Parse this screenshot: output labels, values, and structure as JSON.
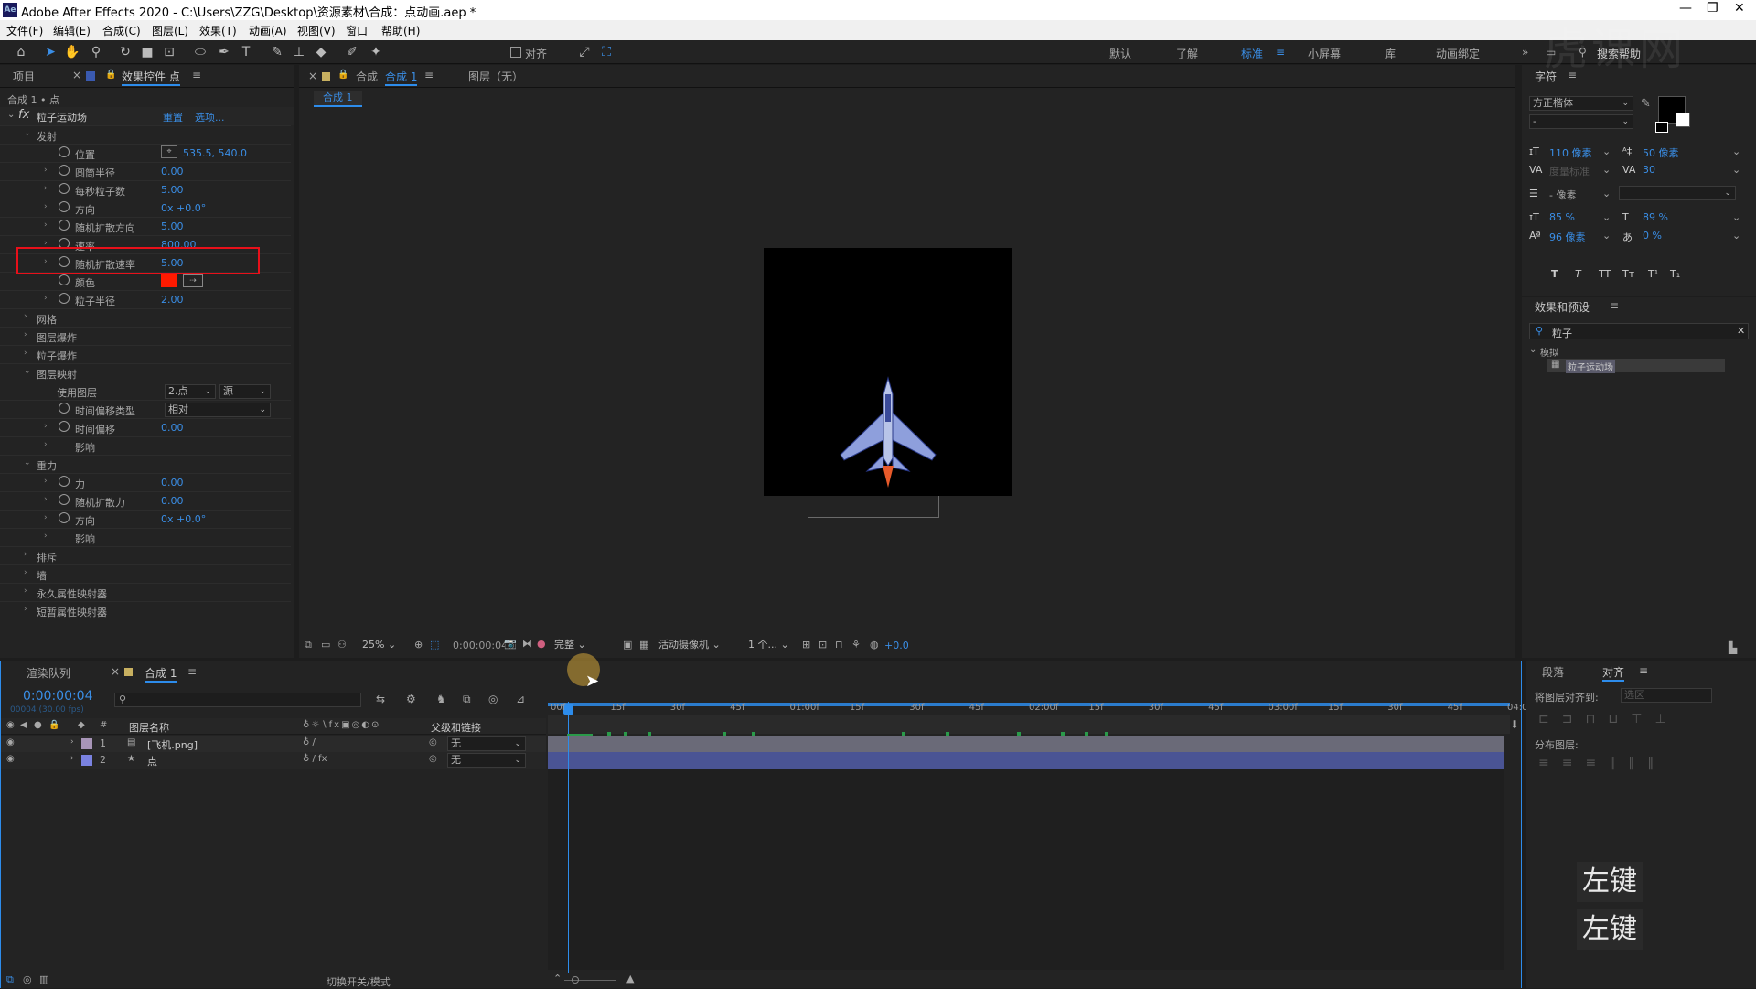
{
  "window": {
    "title": "Adobe After Effects 2020 - C:\\Users\\ZZG\\Desktop\\资源素材\\合成：点动画.aep *",
    "logo": "Ae"
  },
  "menu": [
    "文件(F)",
    "编辑(E)",
    "合成(C)",
    "图层(L)",
    "效果(T)",
    "动画(A)",
    "视图(V)",
    "窗口",
    "帮助(H)"
  ],
  "toolbar": {
    "align_label": "对齐",
    "workspaces": [
      "默认",
      "了解",
      "标准",
      "小屏幕",
      "库",
      "动画绑定"
    ],
    "active_workspace": "标准",
    "search_help": "搜索帮助"
  },
  "left_panel": {
    "tabs": [
      "项目",
      "效果控件 点"
    ],
    "breadcrumb": "合成 1 • 点",
    "effect_name": "粒子运动场",
    "reset": "重置",
    "options": "选项...",
    "rows": [
      {
        "label": "发射",
        "value": "",
        "indent": 1,
        "twirl": "open"
      },
      {
        "label": "位置",
        "value": "535.5, 540.0",
        "indent": 3,
        "stopwatch": true
      },
      {
        "label": "圆筒半径",
        "value": "0.00",
        "indent": 3,
        "twirl": "closed",
        "stopwatch": true
      },
      {
        "label": "每秒粒子数",
        "value": "5.00",
        "indent": 3,
        "twirl": "closed",
        "stopwatch": true
      },
      {
        "label": "方向",
        "value": "0x +0.0°",
        "indent": 3,
        "twirl": "closed",
        "stopwatch": true
      },
      {
        "label": "随机扩散方向",
        "value": "5.00",
        "indent": 3,
        "twirl": "closed",
        "stopwatch": true
      },
      {
        "label": "速率",
        "value": "800.00",
        "indent": 3,
        "twirl": "closed",
        "stopwatch": true
      },
      {
        "label": "随机扩散速率",
        "value": "5.00",
        "indent": 3,
        "twirl": "closed",
        "stopwatch": true,
        "highlight": true
      },
      {
        "label": "颜色",
        "value": "",
        "indent": 3,
        "stopwatch": true,
        "swatch": "#ff1a00"
      },
      {
        "label": "粒子半径",
        "value": "2.00",
        "indent": 3,
        "twirl": "closed",
        "stopwatch": true
      },
      {
        "label": "网格",
        "value": "",
        "indent": 1,
        "twirl": "closed"
      },
      {
        "label": "图层爆炸",
        "value": "",
        "indent": 1,
        "twirl": "closed"
      },
      {
        "label": "粒子爆炸",
        "value": "",
        "indent": 1,
        "twirl": "closed"
      },
      {
        "label": "图层映射",
        "value": "",
        "indent": 1,
        "twirl": "open"
      },
      {
        "label": "使用图层",
        "value": "",
        "indent": 4,
        "dd1": "2.点",
        "dd2": "源"
      },
      {
        "label": "时间偏移类型",
        "value": "",
        "indent": 3,
        "stopwatch": true,
        "dd3": "相对"
      },
      {
        "label": "时间偏移",
        "value": "0.00",
        "indent": 3,
        "twirl": "closed",
        "stopwatch": true
      },
      {
        "label": "影响",
        "value": "",
        "indent": 3,
        "twirl": "closed"
      },
      {
        "label": "重力",
        "value": "",
        "indent": 1,
        "twirl": "open"
      },
      {
        "label": "力",
        "value": "0.00",
        "indent": 3,
        "twirl": "closed",
        "stopwatch": true
      },
      {
        "label": "随机扩散力",
        "value": "0.00",
        "indent": 3,
        "twirl": "closed",
        "stopwatch": true
      },
      {
        "label": "方向",
        "value": "0x +0.0°",
        "indent": 3,
        "twirl": "closed",
        "stopwatch": true
      },
      {
        "label": "影响",
        "value": "",
        "indent": 3,
        "twirl": "closed"
      },
      {
        "label": "排斥",
        "value": "",
        "indent": 1,
        "twirl": "closed"
      },
      {
        "label": "墙",
        "value": "",
        "indent": 1,
        "twirl": "closed"
      },
      {
        "label": "永久属性映射器",
        "value": "",
        "indent": 1,
        "twirl": "closed"
      },
      {
        "label": "短暂属性映射器",
        "value": "",
        "indent": 1,
        "twirl": "closed"
      }
    ]
  },
  "comp_panel": {
    "tab_prefix": "合成",
    "tab_name": "合成 1",
    "layer_tab": "图层（无）",
    "sub_tab": "合成 1",
    "zoom": "25%",
    "time": "0:00:00:04",
    "quality": "完整",
    "camera": "活动摄像机",
    "views": "1 个...",
    "exposure": "+0.0"
  },
  "char_panel": {
    "title": "字符",
    "font": "方正楷体",
    "style": "-",
    "size": "110 像素",
    "leading": "50 像素",
    "kerning": "度量标准",
    "tracking": "30",
    "stroke": "- 像素",
    "vscale": "85 %",
    "hscale": "89 %",
    "baseline": "96 像素",
    "tsume": "0 %",
    "styles": [
      "T",
      "T",
      "TT",
      "Tт",
      "T¹",
      "T₁"
    ]
  },
  "fx_panel": {
    "title": "效果和预设",
    "search": "粒子",
    "category": "模拟",
    "item": "粒子运动场"
  },
  "timeline": {
    "tabs": [
      "渲染队列",
      "合成 1"
    ],
    "time": "0:00:00:04",
    "fps": "00004 (30.00 fps)",
    "col_name": "图层名称",
    "col_parent": "父级和链接",
    "layers": [
      {
        "num": "1",
        "name": "[飞机.png]",
        "parent": "无",
        "color": "#a895b8",
        "bar": "#6a6a78"
      },
      {
        "num": "2",
        "name": "点",
        "parent": "无",
        "color": "#7a82e0",
        "bar": "#4a5494"
      }
    ],
    "ruler": [
      "00f",
      "15f",
      "30f",
      "45f",
      "01:00f",
      "15f",
      "30f",
      "45f",
      "02:00f",
      "15f",
      "30f",
      "45f",
      "03:00f",
      "15f",
      "30f",
      "45f",
      "04:0"
    ],
    "footer": "切换开关/模式"
  },
  "right_bottom": {
    "tabs": [
      "段落",
      "对齐"
    ],
    "align_to": "将图层对齐到:",
    "align_to_value": "选区",
    "distribute": "分布图层:"
  },
  "overlay": {
    "key1": "左键",
    "key2": "左键"
  },
  "watermark": "虎课网"
}
